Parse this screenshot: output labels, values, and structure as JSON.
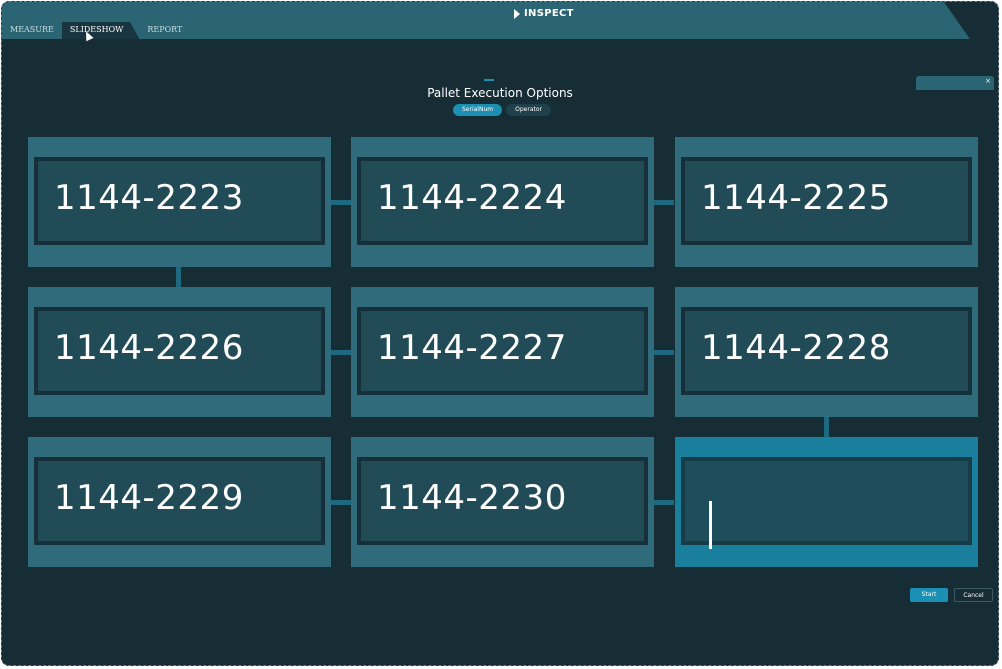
{
  "app": {
    "title": "INSPECT",
    "icons": {
      "title": "play-icon",
      "cursor": "mouse-cursor-icon",
      "close": "close-icon"
    }
  },
  "tabs": [
    {
      "label": "MEASURE",
      "active": false
    },
    {
      "label": "SLIDESHOW",
      "active": true
    },
    {
      "label": "REPORT",
      "active": false
    }
  ],
  "dialog": {
    "title": "Pallet Execution Options",
    "close_glyph": "×",
    "modes": [
      {
        "label": "SerialNum",
        "active": true
      },
      {
        "label": "Operator",
        "active": false
      }
    ]
  },
  "serials": [
    "1144-2223",
    "1144-2224",
    "1144-2225",
    "1144-2226",
    "1144-2227",
    "1144-2228",
    "1144-2229",
    "1144-2230",
    ""
  ],
  "actions": {
    "start_label": "Start",
    "cancel_label": "Cancel"
  },
  "colors": {
    "background": "#172d36",
    "header": "#2b6472",
    "cell": "#2f6b7a",
    "accent": "#1c8fb4"
  }
}
